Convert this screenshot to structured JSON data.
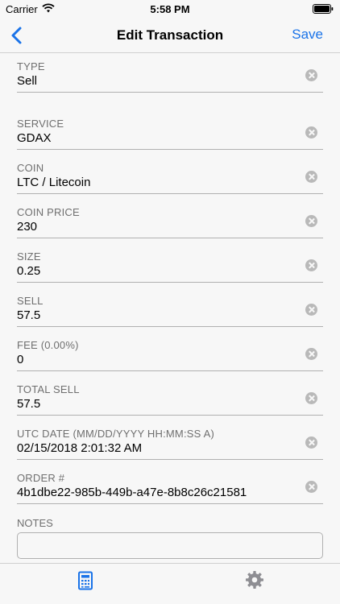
{
  "status_bar": {
    "carrier": "Carrier",
    "time": "5:58 PM"
  },
  "nav": {
    "title": "Edit Transaction",
    "save_label": "Save"
  },
  "fields": [
    {
      "label": "TYPE",
      "value": "Sell"
    },
    {
      "label": "SERVICE",
      "value": "GDAX"
    },
    {
      "label": "COIN",
      "value": "LTC / Litecoin"
    },
    {
      "label": "COIN PRICE",
      "value": "230"
    },
    {
      "label": "SIZE",
      "value": "0.25"
    },
    {
      "label": "SELL",
      "value": "57.5"
    },
    {
      "label": "FEE (0.00%)",
      "value": "0"
    },
    {
      "label": "TOTAL SELL",
      "value": "57.5"
    },
    {
      "label": "UTC DATE (MM/DD/YYYY HH:MM:SS A)",
      "value": "02/15/2018 2:01:32 AM"
    },
    {
      "label": "ORDER #",
      "value": "4b1dbe22-985b-449b-a47e-8b8c26c21581"
    }
  ],
  "notes": {
    "label": "NOTES",
    "value": ""
  },
  "tabs": [
    {
      "icon": "calculator-icon",
      "active": true
    },
    {
      "icon": "gear-icon",
      "active": false
    }
  ],
  "colors": {
    "accent": "#1a73e8",
    "inactive_icon": "#8e8e93"
  }
}
